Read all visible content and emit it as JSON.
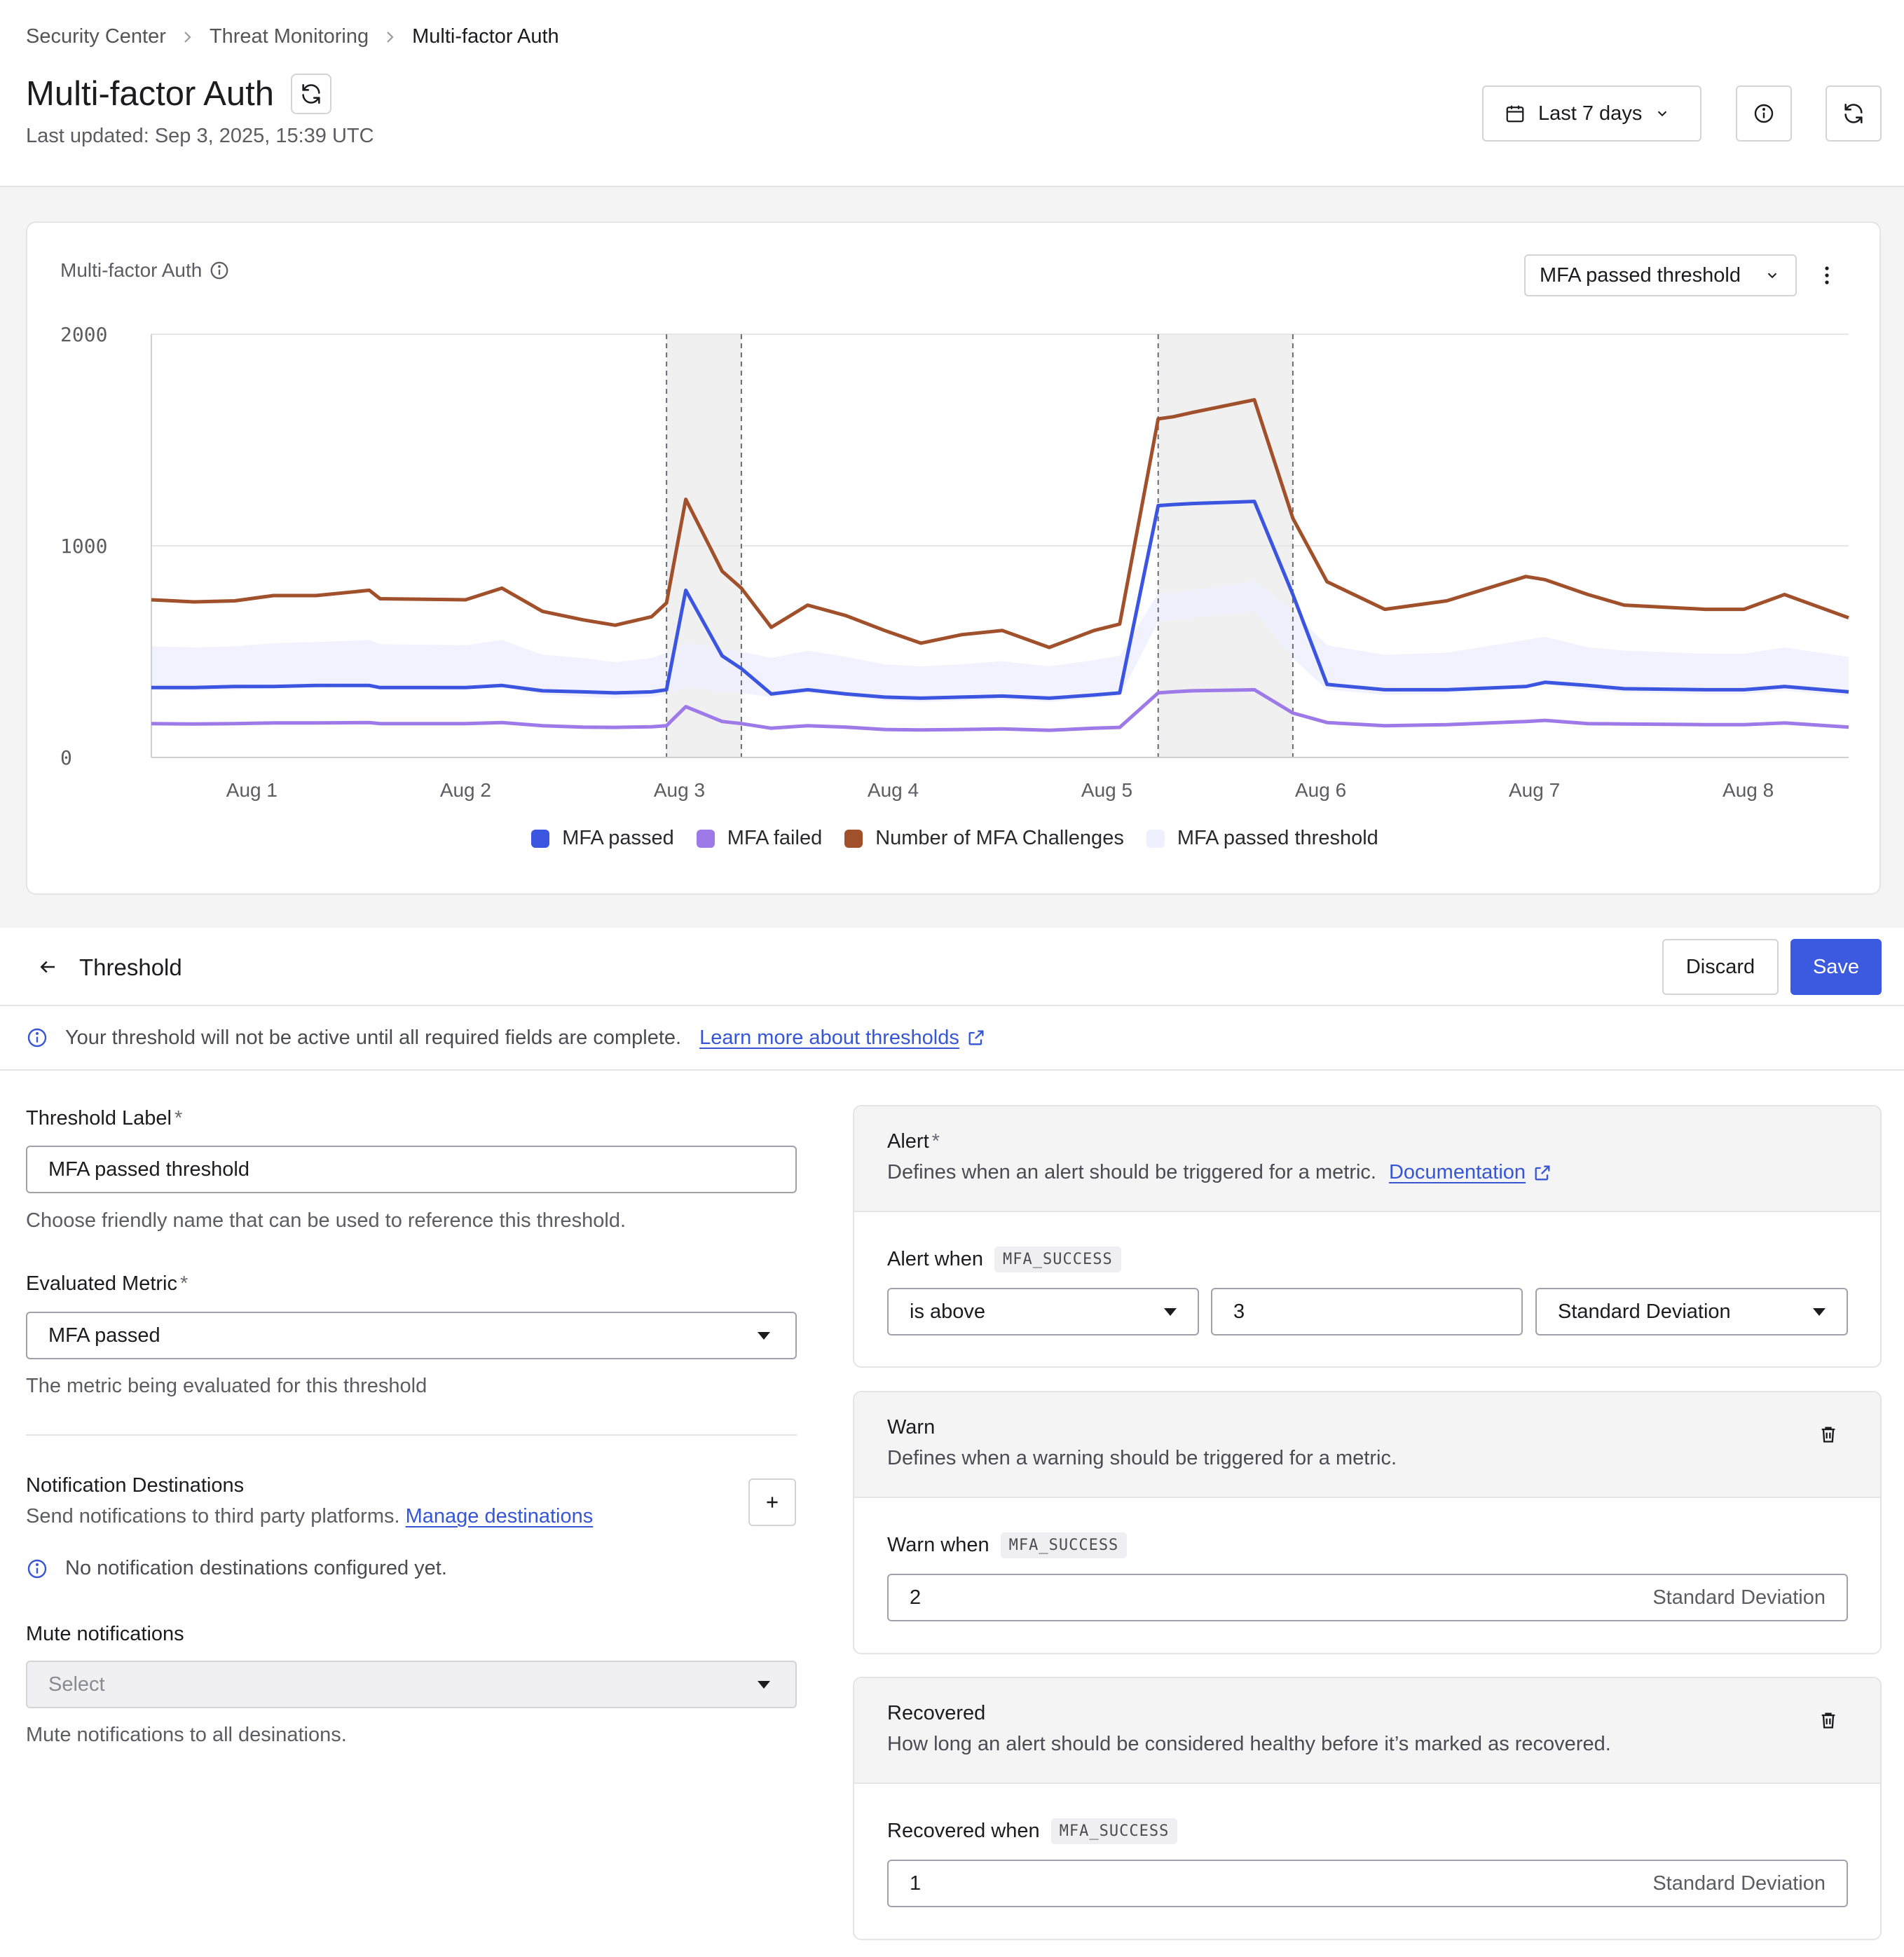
{
  "breadcrumb": [
    "Security Center",
    "Threat Monitoring",
    "Multi-factor Auth"
  ],
  "header": {
    "title": "Multi-factor Auth",
    "last_updated": "Last updated: Sep 3, 2025, 15:39 UTC",
    "date_range": "Last 7 days"
  },
  "chart_panel": {
    "title": "Multi-factor Auth",
    "series_select": "MFA passed threshold"
  },
  "chart_data": {
    "type": "line",
    "title": "Multi-factor Auth",
    "ylim": [
      0,
      2000
    ],
    "yticks": [
      {
        "v": 0,
        "label": "0"
      },
      {
        "v": 1000,
        "label": "1000"
      },
      {
        "v": 2000,
        "label": "2000"
      }
    ],
    "xlim": [
      0.53,
      8.47
    ],
    "xticks": [
      {
        "v": 1,
        "label": "Aug 1"
      },
      {
        "v": 2,
        "label": "Aug 2"
      },
      {
        "v": 3,
        "label": "Aug 3"
      },
      {
        "v": 4,
        "label": "Aug 4"
      },
      {
        "v": 5,
        "label": "Aug 5"
      },
      {
        "v": 6,
        "label": "Aug 6"
      },
      {
        "v": 7,
        "label": "Aug 7"
      },
      {
        "v": 8,
        "label": "Aug 8"
      }
    ],
    "grid": true,
    "legend_position": "bottom-center",
    "anomaly_windows": [
      [
        2.94,
        3.29
      ],
      [
        5.24,
        5.87
      ]
    ],
    "x": [
      0.53,
      0.73,
      0.92,
      1.1,
      1.3,
      1.55,
      1.6,
      2.0,
      2.17,
      2.36,
      2.55,
      2.7,
      2.87,
      2.94,
      3.03,
      3.2,
      3.29,
      3.43,
      3.6,
      3.78,
      3.96,
      4.13,
      4.32,
      4.51,
      4.73,
      4.94,
      5.06,
      5.24,
      5.31,
      5.4,
      5.69,
      5.87,
      6.03,
      6.3,
      6.59,
      6.96,
      7.05,
      7.25,
      7.42,
      7.8,
      7.98,
      8.17,
      8.47
    ],
    "series": [
      {
        "name": "Number of MFA Challenges",
        "color": "#a0502a",
        "values": [
          745,
          735,
          740,
          765,
          765,
          790,
          750,
          745,
          800,
          690,
          650,
          625,
          665,
          730,
          1220,
          880,
          800,
          615,
          720,
          670,
          600,
          540,
          580,
          600,
          520,
          600,
          630,
          1600,
          1610,
          1630,
          1690,
          1130,
          830,
          700,
          740,
          855,
          840,
          770,
          720,
          700,
          700,
          770,
          660
        ]
      },
      {
        "name": "MFA passed",
        "color": "#3b55e0",
        "values": [
          330,
          330,
          335,
          335,
          340,
          340,
          330,
          330,
          340,
          315,
          310,
          305,
          310,
          320,
          790,
          480,
          420,
          300,
          320,
          300,
          285,
          280,
          285,
          290,
          280,
          295,
          305,
          1190,
          1195,
          1200,
          1210,
          770,
          345,
          320,
          320,
          335,
          355,
          340,
          325,
          320,
          320,
          335,
          310
        ]
      },
      {
        "name": "MFA failed",
        "color": "#9e7ae8",
        "values": [
          160,
          158,
          160,
          163,
          163,
          165,
          160,
          160,
          165,
          150,
          143,
          142,
          145,
          150,
          240,
          170,
          160,
          138,
          150,
          143,
          132,
          130,
          132,
          135,
          128,
          138,
          142,
          305,
          310,
          315,
          320,
          210,
          165,
          150,
          155,
          170,
          175,
          160,
          158,
          155,
          155,
          163,
          143
        ]
      }
    ],
    "threshold_band": {
      "name": "MFA passed threshold",
      "color": "#eef0fd",
      "upper": [
        525,
        520,
        525,
        540,
        545,
        555,
        535,
        530,
        555,
        485,
        470,
        450,
        470,
        495,
        545,
        510,
        500,
        470,
        505,
        475,
        440,
        430,
        440,
        455,
        430,
        460,
        480,
        775,
        780,
        790,
        835,
        690,
        530,
        485,
        495,
        555,
        570,
        520,
        505,
        490,
        490,
        520,
        475
      ],
      "lower": [
        320,
        316,
        320,
        327,
        329,
        336,
        324,
        322,
        336,
        297,
        287,
        279,
        286,
        300,
        330,
        310,
        305,
        285,
        305,
        288,
        268,
        262,
        268,
        275,
        262,
        280,
        290,
        640,
        650,
        660,
        690,
        470,
        320,
        297,
        302,
        335,
        345,
        318,
        308,
        300,
        300,
        315,
        290
      ]
    }
  },
  "legend": [
    {
      "label": "MFA passed",
      "color": "#3b55e0"
    },
    {
      "label": "MFA failed",
      "color": "#9e7ae8"
    },
    {
      "label": "Number of MFA Challenges",
      "color": "#a0502a"
    },
    {
      "label": "MFA passed threshold",
      "color": "#eef0fd"
    }
  ],
  "threshold": {
    "title": "Threshold",
    "discard_label": "Discard",
    "save_label": "Save"
  },
  "banner": {
    "text": "Your threshold will not be active until all required fields are complete.",
    "link": "Learn more about thresholds"
  },
  "form": {
    "label_title": "Threshold Label",
    "required_mark": "*",
    "label_value": "MFA passed threshold",
    "label_help": "Choose friendly name that can be used to reference this threshold.",
    "metric_title": "Evaluated Metric",
    "metric_value": "MFA passed",
    "metric_help": "The metric being evaluated for this threshold",
    "notif_title": "Notification Destinations",
    "notif_desc": "Send notifications to third party platforms.",
    "notif_link": "Manage destinations",
    "notif_empty": "No notification destinations configured yet.",
    "mute_title": "Mute notifications",
    "mute_placeholder": "Select",
    "mute_help": "Mute notifications to all desinations."
  },
  "alert": {
    "title": "Alert",
    "required_mark": "*",
    "desc": "Defines when an alert should be triggered for a metric.",
    "doc_link": "Documentation",
    "when_label": "Alert when",
    "metric_code": "MFA_SUCCESS",
    "operator": "is above",
    "value": "3",
    "unit": "Standard Deviation"
  },
  "warn": {
    "title": "Warn",
    "desc": "Defines when a warning should be triggered for a metric.",
    "when_label": "Warn when",
    "metric_code": "MFA_SUCCESS",
    "value": "2",
    "unit": "Standard Deviation"
  },
  "recovered": {
    "title": "Recovered",
    "desc": "How long an alert should be considered healthy before it’s marked as recovered.",
    "when_label": "Recovered when",
    "metric_code": "MFA_SUCCESS",
    "value": "1",
    "unit": "Standard Deviation"
  }
}
